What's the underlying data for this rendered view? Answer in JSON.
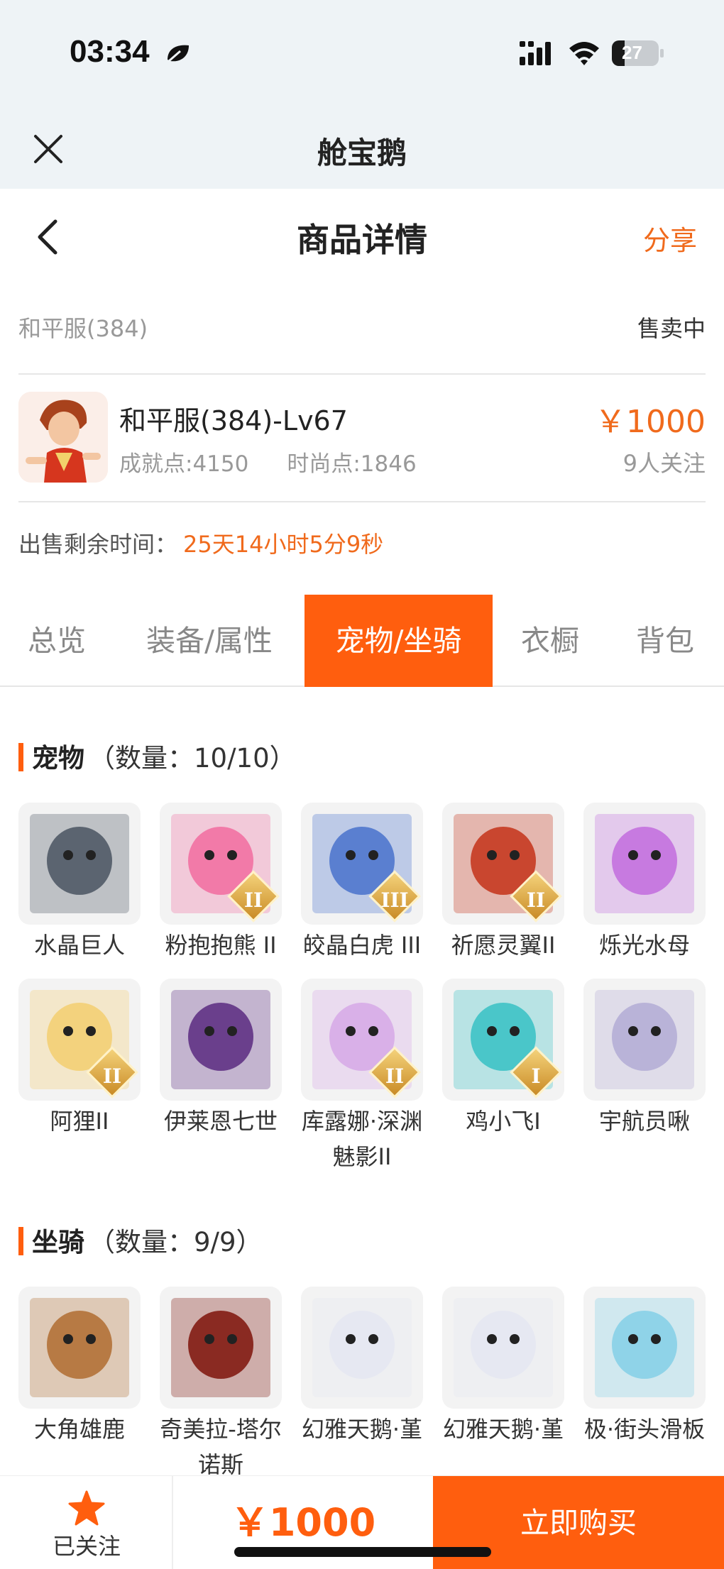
{
  "status_bar": {
    "time": "03:34",
    "battery": "27",
    "battery_level": 0.27
  },
  "mini_app": {
    "title": "舱宝鹅"
  },
  "nav": {
    "title": "商品详情",
    "share": "分享"
  },
  "listing": {
    "server": "和平服(384)",
    "status": "售卖中",
    "name": "和平服(384)-Lv67",
    "achievement": "成就点:4150",
    "fashion": "时尚点:1846",
    "price": "￥1000",
    "followers": "9人关注",
    "remaining_label": "出售剩余时间：",
    "remaining_value": "25天14小时5分9秒"
  },
  "tabs": [
    {
      "label": "总览",
      "active": false
    },
    {
      "label": "装备/属性",
      "active": false
    },
    {
      "label": "宠物/坐骑",
      "active": true
    },
    {
      "label": "衣橱",
      "active": false
    },
    {
      "label": "背包",
      "active": false
    }
  ],
  "pets": {
    "title": "宠物",
    "count": "（数量：10/10）",
    "items": [
      {
        "name": "水晶巨人",
        "badge": "",
        "icon": "crystal-golem-icon",
        "color": "#5b6470"
      },
      {
        "name": "粉抱抱熊 II",
        "badge": "II",
        "icon": "pink-bear-icon",
        "color": "#f27aa8"
      },
      {
        "name": "皎晶白虎 III",
        "badge": "III",
        "icon": "white-tiger-icon",
        "color": "#5a7fd0"
      },
      {
        "name": "祈愿灵翼II",
        "badge": "II",
        "icon": "spirit-wing-icon",
        "color": "#c9462f"
      },
      {
        "name": "烁光水母",
        "badge": "",
        "icon": "jellyfish-icon",
        "color": "#c77ae0"
      },
      {
        "name": "阿狸II",
        "badge": "II",
        "icon": "ali-icon",
        "color": "#f3d27d"
      },
      {
        "name": "伊莱恩七世",
        "badge": "",
        "icon": "elaine-icon",
        "color": "#6a3f8c"
      },
      {
        "name": "库露娜·深渊魅影II",
        "badge": "II",
        "icon": "kuluna-icon",
        "color": "#d9b0e8"
      },
      {
        "name": "鸡小飞I",
        "badge": "I",
        "icon": "chick-icon",
        "color": "#4ac6c9"
      },
      {
        "name": "宇航员啾",
        "badge": "",
        "icon": "astronaut-icon",
        "color": "#b9b3d8"
      }
    ]
  },
  "mounts": {
    "title": "坐骑",
    "count": "（数量：9/9）",
    "items": [
      {
        "name": "大角雄鹿",
        "badge": "",
        "icon": "deer-icon",
        "color": "#b77a44"
      },
      {
        "name": "奇美拉-塔尔诺斯",
        "badge": "",
        "icon": "chimera-icon",
        "color": "#8a2a22"
      },
      {
        "name": "幻雅天鹅·堇",
        "badge": "",
        "icon": "swan-icon",
        "color": "#e6e8f2"
      },
      {
        "name": "幻雅天鹅·堇",
        "badge": "",
        "icon": "swan-icon",
        "color": "#e6e8f2"
      },
      {
        "name": "极·街头滑板",
        "badge": "",
        "icon": "skateboard-icon",
        "color": "#8fd3e8"
      }
    ]
  },
  "bottom": {
    "follow": "已关注",
    "price": "￥1000",
    "buy": "立即购买"
  },
  "colors": {
    "accent": "#ff5e0e",
    "price": "#f06a1c"
  }
}
